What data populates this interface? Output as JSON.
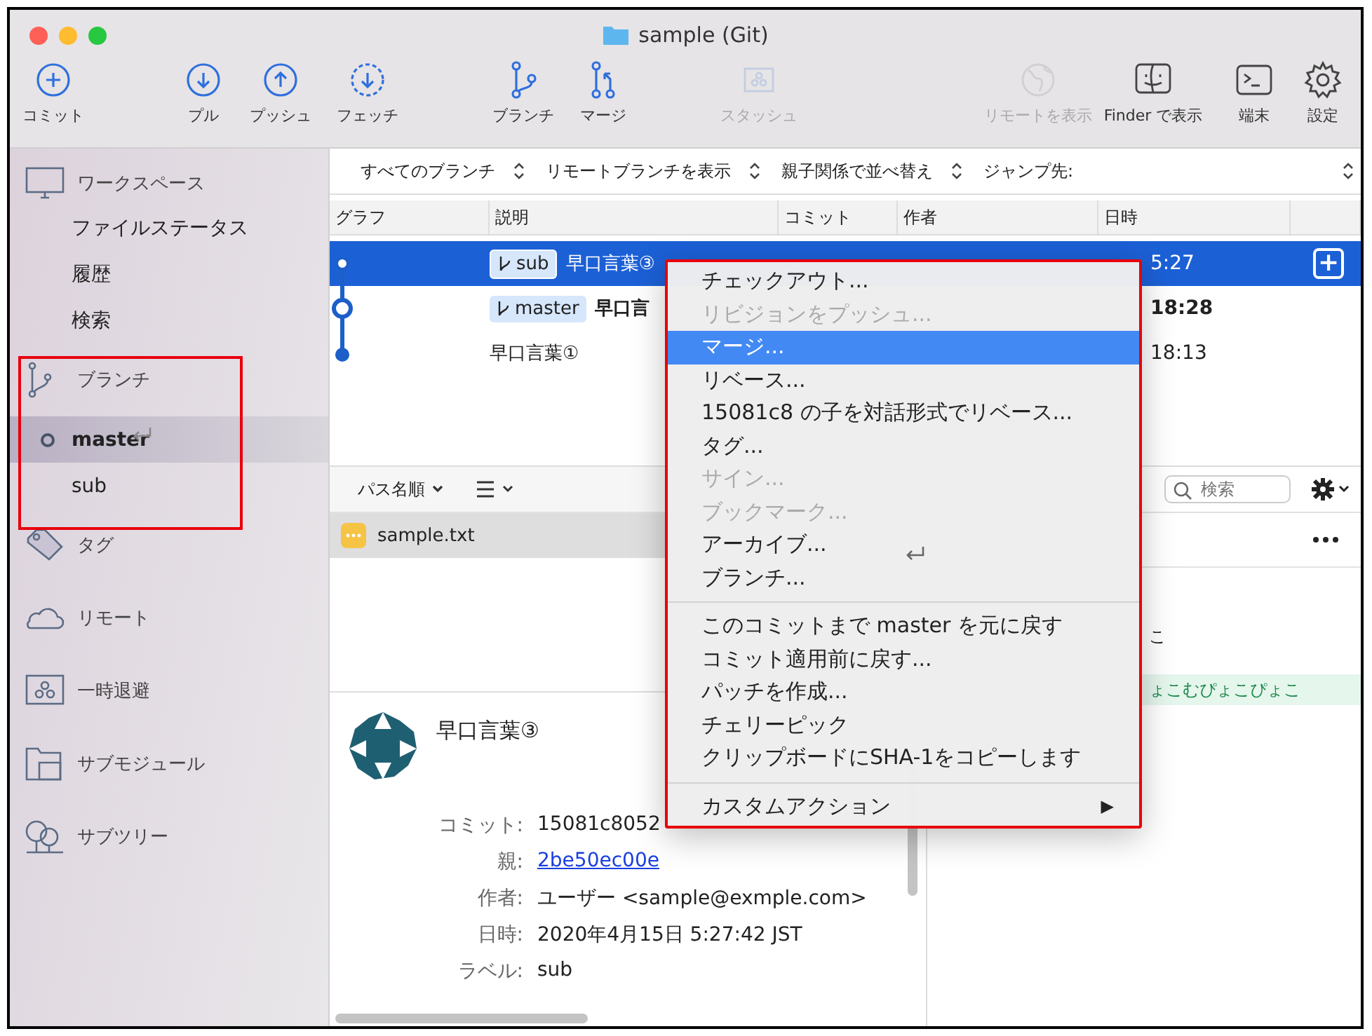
{
  "window": {
    "title": "sample (Git)"
  },
  "toolbar": [
    {
      "label": "コミット",
      "kind": "commit",
      "disabled": false
    },
    {
      "label": "プル",
      "kind": "pull",
      "disabled": false
    },
    {
      "label": "プッシュ",
      "kind": "push",
      "disabled": false
    },
    {
      "label": "フェッチ",
      "kind": "fetch",
      "disabled": false
    },
    {
      "label": "ブランチ",
      "kind": "branch",
      "disabled": false
    },
    {
      "label": "マージ",
      "kind": "merge",
      "disabled": false
    },
    {
      "label": "スタッシュ",
      "kind": "stash",
      "disabled": true
    },
    {
      "label": "リモートを表示",
      "kind": "remote",
      "disabled": true
    },
    {
      "label": "Finder で表示",
      "kind": "finder",
      "disabled": false
    },
    {
      "label": "端末",
      "kind": "terminal",
      "disabled": false
    },
    {
      "label": "設定",
      "kind": "settings",
      "disabled": false
    }
  ],
  "sidebar": [
    {
      "label": "ワークスペース",
      "kind": "workspace",
      "items": [
        {
          "label": "ファイルステータス",
          "selected": false,
          "current": false
        },
        {
          "label": "履歴",
          "selected": false,
          "current": false
        },
        {
          "label": "検索",
          "selected": false,
          "current": false
        }
      ]
    },
    {
      "label": "ブランチ",
      "kind": "branch",
      "items": [
        {
          "label": "master",
          "selected": true,
          "current": true
        },
        {
          "label": "sub",
          "selected": false,
          "current": false
        }
      ]
    },
    {
      "label": "タグ",
      "kind": "tag"
    },
    {
      "label": "リモート",
      "kind": "remote"
    },
    {
      "label": "一時退避",
      "kind": "stash"
    },
    {
      "label": "サブモジュール",
      "kind": "submodule"
    },
    {
      "label": "サブツリー",
      "kind": "subtree"
    }
  ],
  "filters": [
    "すべてのブランチ",
    "リモートブランチを表示",
    "親子関係で並べ替え",
    "ジャンプ先:"
  ],
  "table": {
    "columns": [
      "グラフ",
      "説明",
      "コミット",
      "作者",
      "日時"
    ],
    "rows": [
      {
        "branch": "sub",
        "description": "早口言葉③",
        "date": "5:27",
        "selected": true,
        "bold": false,
        "action": "+"
      },
      {
        "branch": "master",
        "description": "早口言",
        "date": "18:28",
        "selected": false,
        "bold": true
      },
      {
        "description": "早口言葉①",
        "date": "18:13",
        "selected": false,
        "bold": false
      }
    ]
  },
  "files_toolbar": {
    "sort": "パス名順",
    "search_placeholder": "検索"
  },
  "files": [
    {
      "name": "sample.txt",
      "selected": true
    }
  ],
  "details": {
    "title": "早口言葉③",
    "fields": [
      {
        "label": "コミット:",
        "value": "15081c8052",
        "kind": "text"
      },
      {
        "label": "親:",
        "value": "2be50ec00e",
        "kind": "link"
      },
      {
        "label": "作者:",
        "value": "ユーザー <sample@exmple.com>",
        "kind": "text"
      },
      {
        "label": "日時:",
        "value": "2020年4月15日 5:27:42 JST",
        "kind": "text"
      },
      {
        "label": "ラベル:",
        "value": "sub",
        "kind": "text"
      }
    ]
  },
  "diff": [
    {
      "text": "こ",
      "kind": "context"
    },
    {
      "text": "ょこむぴょこぴょこ",
      "kind": "added"
    }
  ],
  "context_menu": [
    {
      "kind": "item",
      "label": "チェックアウト...",
      "disabled": false,
      "selected": false
    },
    {
      "kind": "item",
      "label": "リビジョンをプッシュ...",
      "disabled": true,
      "selected": false
    },
    {
      "kind": "item",
      "label": "マージ...",
      "disabled": false,
      "selected": true
    },
    {
      "kind": "item",
      "label": "リベース...",
      "disabled": false,
      "selected": false
    },
    {
      "kind": "item",
      "label": "15081c8 の子を対話形式でリベース...",
      "disabled": false,
      "selected": false
    },
    {
      "kind": "item",
      "label": "タグ...",
      "disabled": false,
      "selected": false
    },
    {
      "kind": "item",
      "label": "サイン...",
      "disabled": true,
      "selected": false
    },
    {
      "kind": "item",
      "label": "ブックマーク...",
      "disabled": true,
      "selected": false
    },
    {
      "kind": "item",
      "label": "アーカイブ...",
      "disabled": false,
      "selected": false
    },
    {
      "kind": "item",
      "label": "ブランチ...",
      "disabled": false,
      "selected": false
    },
    {
      "kind": "separator"
    },
    {
      "kind": "item",
      "label": "このコミットまで master を元に戻す",
      "disabled": false,
      "selected": false
    },
    {
      "kind": "item",
      "label": "コミット適用前に戻す...",
      "disabled": false,
      "selected": false
    },
    {
      "kind": "item",
      "label": "パッチを作成...",
      "disabled": false,
      "selected": false
    },
    {
      "kind": "item",
      "label": "チェリーピック",
      "disabled": false,
      "selected": false
    },
    {
      "kind": "item",
      "label": "クリップボードにSHA-1をコピーします",
      "disabled": false,
      "selected": false
    },
    {
      "kind": "separator"
    },
    {
      "kind": "submenu",
      "label": "カスタムアクション",
      "arrow": "▶",
      "disabled": false,
      "selected": false
    }
  ]
}
